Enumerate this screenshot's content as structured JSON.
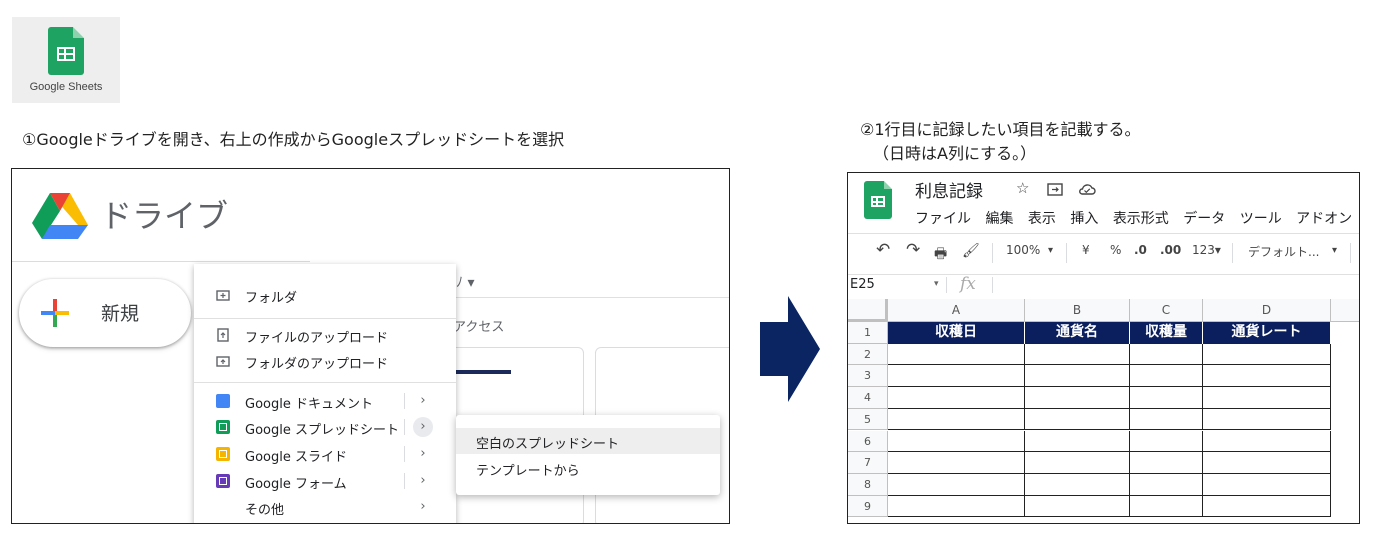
{
  "logo": {
    "caption": "Google Sheets",
    "icon": "google-sheets-icon"
  },
  "step1": {
    "caption": "①Googleドライブを開き、右上の作成からGoogleスプレッドシートを選択"
  },
  "step2": {
    "caption_line1": "②1行目に記録したい項目を記載する。",
    "caption_line2": "（日時はA列にする。）"
  },
  "drive": {
    "title": "ドライブ",
    "new_button": "新規",
    "background_tab": "ﾏｲﾉ ▾",
    "background_access": "アクセス",
    "menu": [
      {
        "label": "フォルダ",
        "icon": "folder-plus-icon"
      },
      {
        "label": "ファイルのアップロード",
        "icon": "file-upload-icon"
      },
      {
        "label": "フォルダのアップロード",
        "icon": "folder-upload-icon"
      },
      {
        "label": "Google ドキュメント",
        "icon": "google-docs-icon"
      },
      {
        "label": "Google スプレッドシート",
        "icon": "google-sheets-icon"
      },
      {
        "label": "Google スライド",
        "icon": "google-slides-icon"
      },
      {
        "label": "Google フォーム",
        "icon": "google-forms-icon"
      },
      {
        "label": "その他",
        "icon": ""
      }
    ],
    "chevron": "›",
    "submenu": [
      "空白のスプレッドシート",
      "テンプレートから"
    ]
  },
  "sheet": {
    "doc_title": "利息記録",
    "menubar": [
      "ファイル",
      "編集",
      "表示",
      "挿入",
      "表示形式",
      "データ",
      "ツール",
      "アドオン"
    ],
    "toolbar": {
      "undo": "↶",
      "redo": "↷",
      "print": "🖶",
      "paint": "🖌",
      "zoom": "100%",
      "zoom_caret": "▾",
      "currency": "¥",
      "percent": "%",
      "dec_less": ".0",
      "dec_more": ".00",
      "format": "123▾",
      "font": "デフォルト...",
      "font_caret": "▾"
    },
    "cell_ref": "E25",
    "cell_ref_caret": "▾",
    "fx": "fx",
    "columns": [
      "A",
      "B",
      "C",
      "D"
    ],
    "rows": [
      "1",
      "2",
      "3",
      "4",
      "5",
      "6",
      "7",
      "8",
      "9"
    ],
    "headers": [
      "収穫日",
      "通貨名",
      "収穫量",
      "通貨レート"
    ]
  },
  "colors": {
    "header_navy": "#0b1f5e",
    "arrow_navy": "#0b2563",
    "sheets_green": "#1ea362"
  }
}
